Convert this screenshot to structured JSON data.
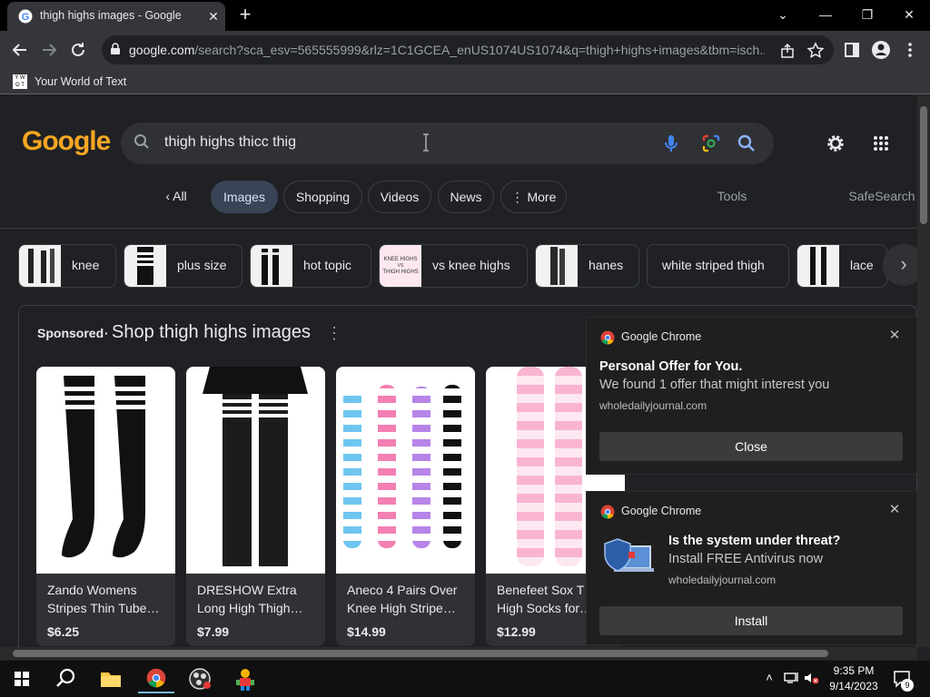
{
  "browser": {
    "tab_title": "thigh highs images - Google Search",
    "tab_close": "✕",
    "new_tab": "+",
    "window_controls": {
      "minimize": "—",
      "restore": "❐",
      "close": "✕",
      "tab_search": "⌄"
    },
    "url_host": "google.com",
    "url_path": "/search?sca_esv=565555999&rlz=1C1GCEA_enUS1074US1074&q=thigh+highs+images&tbm=isch...",
    "bookmark_label": "Your World of Text",
    "bookmark_favicon_text": "Y W O T"
  },
  "google": {
    "logo_text": "Google",
    "search_query": "thigh highs thicc thig",
    "tabs": [
      {
        "label": "All",
        "prefix": "‹"
      },
      {
        "label": "Images"
      },
      {
        "label": "Shopping"
      },
      {
        "label": "Videos"
      },
      {
        "label": "News"
      },
      {
        "label": "More",
        "prefix": "⋮"
      }
    ],
    "tools_label": "Tools",
    "safesearch_label": "SafeSearch",
    "chips": [
      "knee",
      "plus size",
      "hot topic",
      "vs knee highs",
      "hanes",
      "white striped thigh",
      "lace"
    ],
    "chip_thumb_text_vs": "KNEE HIGHS VS THIGH HIGHS",
    "sponsored_label": "Sponsored",
    "sponsored_dot": "·",
    "sponsored_title": "Shop thigh highs images",
    "products": [
      {
        "name": "Zando Womens Stripes Thin Tube…",
        "price": "$6.25"
      },
      {
        "name": "DRESHOW Extra Long High Thigh…",
        "price": "$7.99"
      },
      {
        "name": "Aneco 4 Pairs Over Knee High Stripe…",
        "price": "$14.99"
      },
      {
        "name": "Benefeet Sox T… High Socks for…",
        "price": "$12.99"
      }
    ]
  },
  "notifications": [
    {
      "app": "Google Chrome",
      "title": "Personal Offer for You.",
      "body": "We found 1 offer that might interest you",
      "source": "wholedailyjournal.com",
      "button": "Close"
    },
    {
      "app": "Google Chrome",
      "title": "Is the system under threat?",
      "body": "Install FREE Antivirus now",
      "source": "wholedailyjournal.com",
      "button": "Install"
    }
  ],
  "taskbar": {
    "time": "9:35 PM",
    "date": "9/14/2023",
    "notification_count": "9"
  },
  "colors": {
    "page_bg": "#202124",
    "active_tab_bg": "#394457",
    "google_logo": "#f5a623",
    "toolbar_bg": "#35363a"
  }
}
